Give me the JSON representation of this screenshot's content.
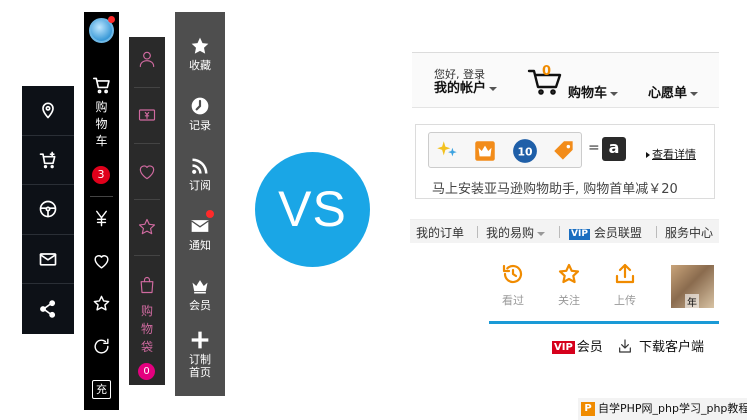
{
  "bar2": {
    "cart_chars": [
      "购",
      "物",
      "车"
    ],
    "cart_count": "3",
    "recharge": "充"
  },
  "bar3": {
    "bag_chars": [
      "购",
      "物",
      "袋"
    ],
    "bag_count": "0",
    "accent": "#d06aa0"
  },
  "bar4": {
    "items": [
      {
        "label": "收藏",
        "icon": "star-icon"
      },
      {
        "label": "记录",
        "icon": "clock-icon"
      },
      {
        "label": "订阅",
        "icon": "rss-icon"
      },
      {
        "label": "通知",
        "icon": "mail-icon"
      },
      {
        "label": "会员",
        "icon": "crown-icon"
      },
      {
        "label_lines": [
          "订制",
          "首页"
        ],
        "icon": "plus-icon"
      }
    ]
  },
  "vs_text": "VS",
  "amazon": {
    "greeting": "您好, 登录",
    "account": "我的帐户",
    "cart_count": "0",
    "cart": "购物车",
    "wishlist": "心愿单",
    "equals": "=",
    "amazon_logo": "a",
    "badge_number": "10",
    "more_details": "查看详情",
    "promo_text": "马上安装亚马逊购物助手, 购物首单减￥20",
    "subnav": [
      "我的订单",
      "我的易购",
      "会员联盟",
      "服务中心"
    ],
    "vip_tag": "VIP",
    "quick": [
      "看过",
      "关注",
      "上传"
    ],
    "photo_tag": "年",
    "vip_red": "VIP",
    "member": "会员",
    "download": "下载客户端",
    "accent": "#f08b00",
    "blue": "#1a9ad6"
  },
  "watermark": {
    "logo": "P",
    "text": "自学PHP网_php学习_php教程"
  }
}
